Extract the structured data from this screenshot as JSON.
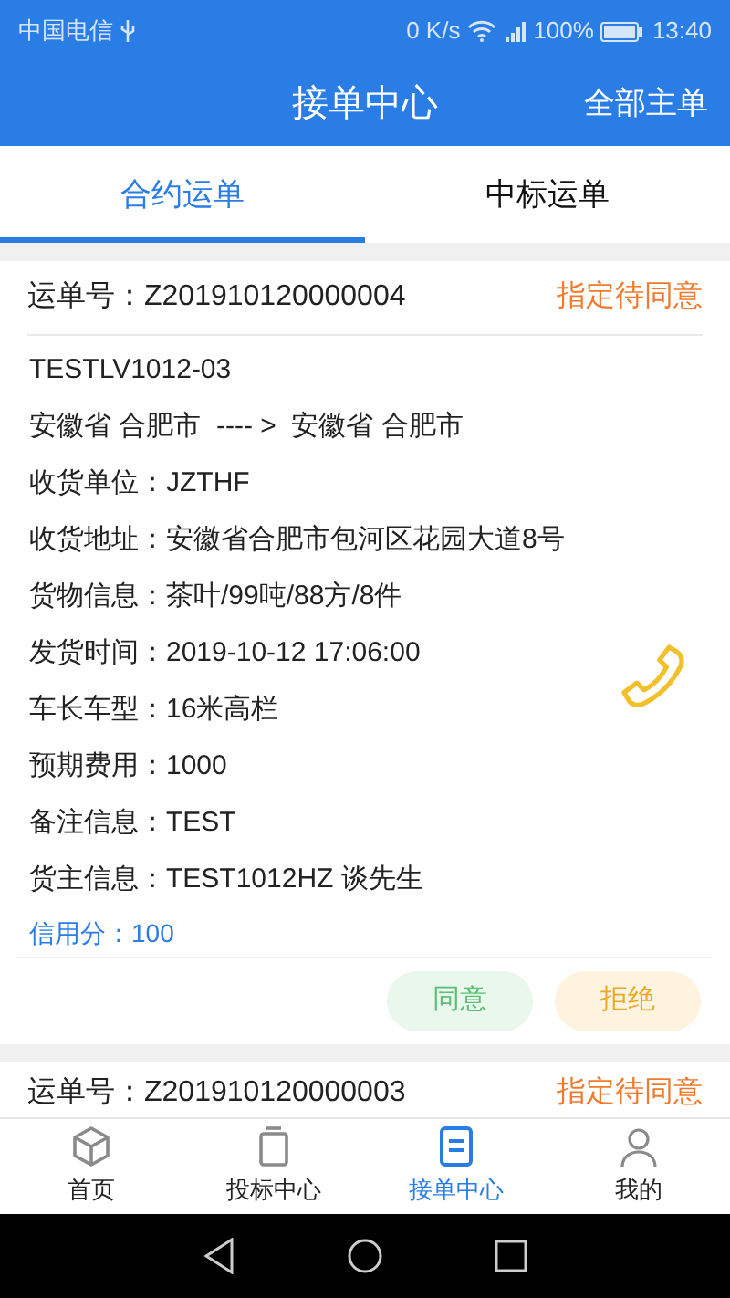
{
  "status_bar": {
    "carrier": "中国电信",
    "speed": "0 K/s",
    "battery": "100%",
    "time": "13:40"
  },
  "header": {
    "title": "接单中心",
    "action": "全部主单"
  },
  "tabs": [
    {
      "label": "合约运单",
      "selected": true
    },
    {
      "label": "中标运单",
      "selected": false
    }
  ],
  "orders": [
    {
      "waybill": "运单号：Z201910120000004",
      "status": "指定待同意",
      "code": "TESTLV1012-03",
      "route": "安徽省 合肥市  ---- >  安徽省 合肥市",
      "details": [
        "收货单位：JZTHF",
        "收货地址：安徽省合肥市包河区花园大道8号",
        "货物信息：茶叶/99吨/88方/8件",
        "发货时间：2019-10-12 17:06:00",
        "车长车型：16米高栏",
        "预期费用：1000",
        "备注信息：TEST",
        "货主信息：TEST1012HZ  谈先生"
      ],
      "credit": "信用分：100",
      "buttons": [
        {
          "label": "同意",
          "kind": "agree"
        },
        {
          "label": "拒绝",
          "kind": "reject"
        }
      ]
    },
    {
      "waybill": "运单号：Z201910120000003",
      "status": "指定待同意"
    }
  ],
  "bottom_nav": [
    {
      "label": "首页",
      "kind": "home",
      "selected": false
    },
    {
      "label": "投标中心",
      "kind": "bid",
      "selected": false
    },
    {
      "label": "接单中心",
      "kind": "orders",
      "selected": true
    },
    {
      "label": "我的",
      "kind": "me",
      "selected": false
    }
  ]
}
